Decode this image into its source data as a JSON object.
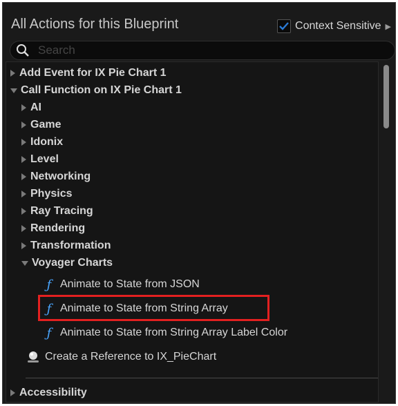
{
  "panel": {
    "title": "All Actions for this Blueprint",
    "context_sensitive_label": "Context Sensitive",
    "context_sensitive_checked": true
  },
  "search": {
    "placeholder": "Search",
    "value": ""
  },
  "tree": {
    "add_event": "Add Event for IX Pie Chart 1",
    "call_function": "Call Function on IX Pie Chart 1",
    "categories": [
      "AI",
      "Game",
      "Idonix",
      "Level",
      "Networking",
      "Physics",
      "Ray Tracing",
      "Rendering",
      "Transformation"
    ],
    "voyager": {
      "label": "Voyager Charts",
      "functions": [
        "Animate to State from JSON",
        "Animate to State from String Array",
        "Animate to State from String Array Label Color"
      ]
    },
    "create_reference": "Create a Reference to IX_PieChart",
    "accessibility": "Accessibility"
  },
  "colors": {
    "accent": "#2a7ad6",
    "function_icon": "#4aa6ff",
    "highlight": "#e32020"
  },
  "icons": {
    "search": "search-icon",
    "function": "function-icon",
    "reference": "reference-icon"
  }
}
